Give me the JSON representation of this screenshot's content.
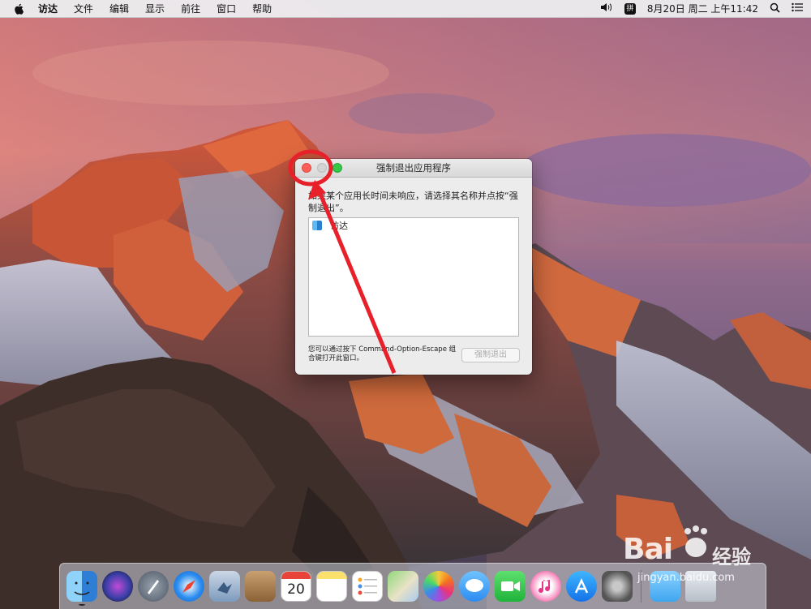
{
  "menubar": {
    "apple_icon": "apple-icon",
    "items": [
      "访达",
      "文件",
      "编辑",
      "显示",
      "前往",
      "窗口",
      "帮助"
    ],
    "status": {
      "volume_icon": "speaker-icon",
      "input_method": "拼",
      "datetime": "8月20日 周二 上午11:42",
      "search_icon": "magnifier-icon",
      "notification_icon": "list-icon"
    }
  },
  "dialog": {
    "title": "强制退出应用程序",
    "message": "如果某个应用长时间未响应，请选择其名称并点按“强制退出”。",
    "apps": [
      "访达"
    ],
    "hint": "您可以通过按下 Command-Option-Escape 组合键打开此窗口。",
    "force_quit_button": "强制退出",
    "colors": {
      "close": "#fc5f57",
      "minimize": "#d4d4d4",
      "zoom": "#34c848"
    }
  },
  "dock": {
    "apps": [
      "finder",
      "siri",
      "launchpad",
      "safari",
      "mail",
      "contacts",
      "calendar",
      "notes",
      "reminders",
      "maps",
      "photos",
      "messages",
      "facetime",
      "itunes",
      "app-store",
      "system-preferences",
      "downloads",
      "trash"
    ],
    "calendar_day": "20"
  },
  "watermark": {
    "brand": "Bai",
    "cn": "经验",
    "url": "jingyan.baidu.com"
  },
  "annotation_color": "#e8202a"
}
